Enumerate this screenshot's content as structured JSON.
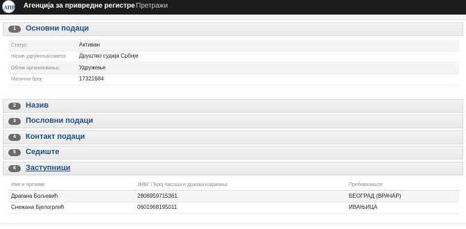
{
  "header": {
    "title": "Агенција за привредне регистре",
    "nav_search": "Претражи"
  },
  "sections": [
    {
      "number": "1",
      "title": "Основни подаци"
    },
    {
      "number": "2",
      "title": "Назив"
    },
    {
      "number": "3",
      "title": "Пословни подаци"
    },
    {
      "number": "4",
      "title": "Контакт подаци"
    },
    {
      "number": "5",
      "title": "Седиште"
    },
    {
      "number": "6",
      "title": "Заступници"
    }
  ],
  "basic_info": [
    {
      "label": "Статус:",
      "value": "Активан"
    },
    {
      "label": "Назив удружења/савеза:",
      "value": "Друштво судија Србије"
    },
    {
      "label": "Облик организовања:",
      "value": "Удружење"
    },
    {
      "label": "Матични број:",
      "value": "17321684"
    }
  ],
  "representatives": {
    "columns": [
      "Име и презиме",
      "ЈМБГ / Број пасоша и држава издавања",
      "Пребивалиште"
    ],
    "rows": [
      [
        "Драгана Бољевић",
        "2806959715361",
        "БЕОГРАД (ВРАЧАР)"
      ],
      [
        "Снежана Бјелогрлић",
        "0601968195011",
        "ИВАЊИЦА"
      ]
    ]
  }
}
